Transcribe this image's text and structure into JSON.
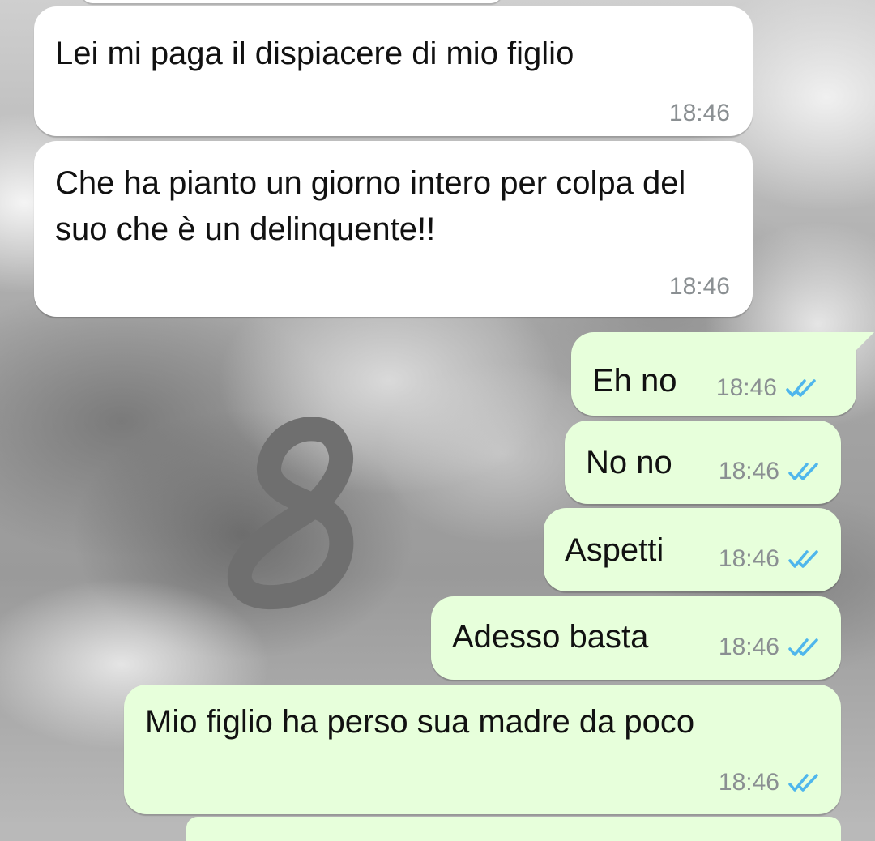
{
  "colors": {
    "incoming_bubble": "#ffffff",
    "outgoing_bubble": "#e7ffdb",
    "read_ticks": "#4fb6ec",
    "timestamp": "#8a8f92",
    "doodle": "#6f6f6f"
  },
  "messages": [
    {
      "direction": "incoming",
      "text": "Lei mi paga il dispiacere di mio figlio",
      "time": "18:46"
    },
    {
      "direction": "incoming",
      "text": "Che ha pianto un giorno intero per colpa del suo che è un delinquente!!",
      "time": "18:46"
    },
    {
      "direction": "outgoing",
      "text": "Eh no",
      "time": "18:46",
      "status_icon": "double-check-read-icon"
    },
    {
      "direction": "outgoing",
      "text": "No no",
      "time": "18:46",
      "status_icon": "double-check-read-icon"
    },
    {
      "direction": "outgoing",
      "text": "Aspetti",
      "time": "18:46",
      "status_icon": "double-check-read-icon"
    },
    {
      "direction": "outgoing",
      "text": "Adesso basta",
      "time": "18:46",
      "status_icon": "double-check-read-icon"
    },
    {
      "direction": "outgoing",
      "text": "Mio figlio ha perso sua madre da poco",
      "time": "18:46",
      "status_icon": "double-check-read-icon"
    }
  ],
  "doodle": {
    "icon": "hand-drawn-8-scribble"
  }
}
